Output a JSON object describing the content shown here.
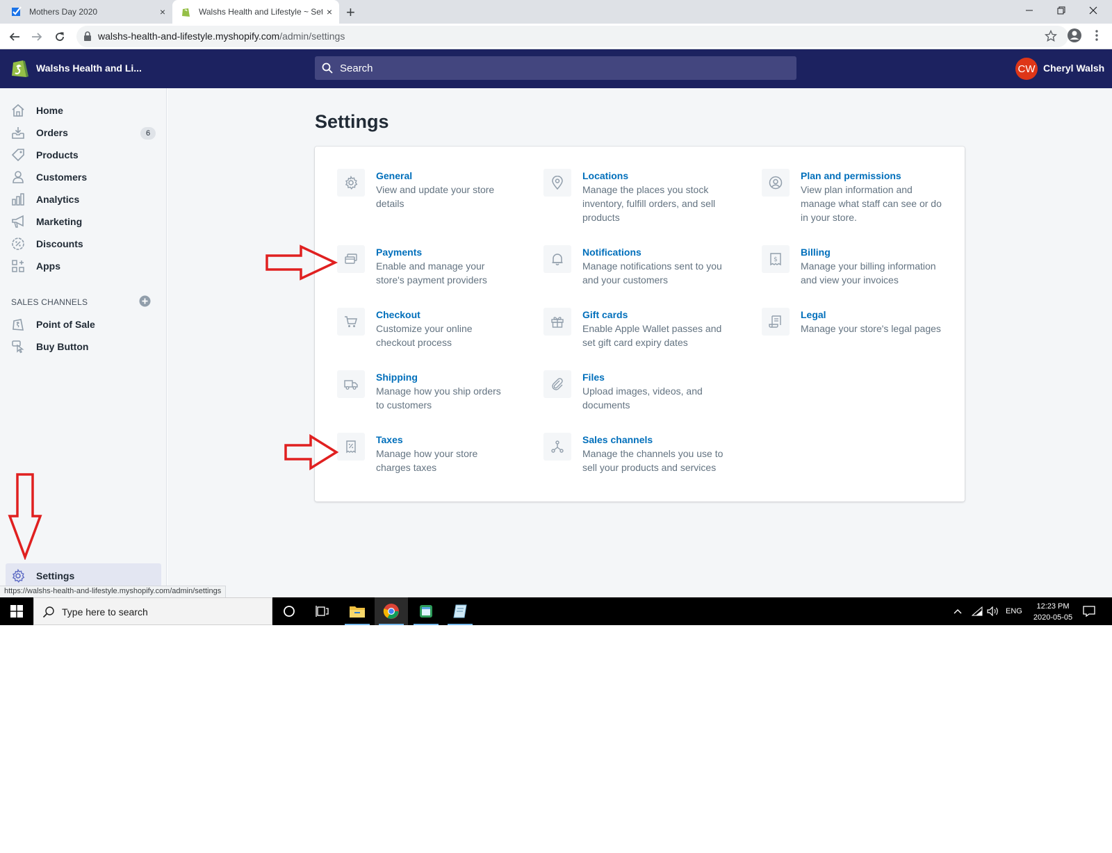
{
  "browser": {
    "tabs": [
      {
        "title": "Mothers Day 2020",
        "close": "×"
      },
      {
        "title": "Walshs Health and Lifestyle ~ Settings",
        "close": "×"
      }
    ],
    "new_tab": "+",
    "url_domain": "walshs-health-and-lifestyle.myshopify.com",
    "url_path": "/admin/settings",
    "status_url": "https://walshs-health-and-lifestyle.myshopify.com/admin/settings"
  },
  "topbar": {
    "shop_name": "Walshs Health and Li...",
    "search_placeholder": "Search",
    "avatar_initials": "CW",
    "user_name": "Cheryl Walsh",
    "accent": "#1c2260",
    "avatar_color": "#de3618"
  },
  "sidebar": {
    "items": [
      {
        "label": "Home",
        "icon": "home-icon"
      },
      {
        "label": "Orders",
        "icon": "orders-icon",
        "badge": "6"
      },
      {
        "label": "Products",
        "icon": "tag-icon"
      },
      {
        "label": "Customers",
        "icon": "person-icon"
      },
      {
        "label": "Analytics",
        "icon": "bar-chart-icon"
      },
      {
        "label": "Marketing",
        "icon": "megaphone-icon"
      },
      {
        "label": "Discounts",
        "icon": "discount-icon"
      },
      {
        "label": "Apps",
        "icon": "apps-icon"
      }
    ],
    "sales_channels_heading": "SALES CHANNELS",
    "channels": [
      {
        "label": "Point of Sale",
        "icon": "pos-icon"
      },
      {
        "label": "Buy Button",
        "icon": "buy-button-icon"
      }
    ],
    "settings_label": "Settings"
  },
  "main": {
    "title": "Settings",
    "settings": [
      {
        "title": "General",
        "desc": [
          "View and update your store",
          "details"
        ],
        "icon": "gear-icon"
      },
      {
        "title": "Locations",
        "desc": [
          "Manage the places you stock",
          "inventory, fulfill orders, and sell",
          "products"
        ],
        "icon": "location-pin-icon"
      },
      {
        "title": "Plan and permissions",
        "desc": [
          "View plan information and",
          "manage what staff can see or do",
          "in your store."
        ],
        "icon": "user-circle-icon"
      },
      {
        "title": "Payments",
        "desc": [
          "Enable and manage your",
          "store's payment providers"
        ],
        "icon": "payments-icon"
      },
      {
        "title": "Notifications",
        "desc": [
          "Manage notifications sent to you",
          "and your customers"
        ],
        "icon": "bell-icon"
      },
      {
        "title": "Billing",
        "desc": [
          "Manage your billing information",
          "and view your invoices"
        ],
        "icon": "invoice-icon"
      },
      {
        "title": "Checkout",
        "desc": [
          "Customize your online",
          "checkout process"
        ],
        "icon": "cart-icon"
      },
      {
        "title": "Gift cards",
        "desc": [
          "Enable Apple Wallet passes and",
          "set gift card expiry dates"
        ],
        "icon": "gift-icon"
      },
      {
        "title": "Legal",
        "desc": [
          "Manage your store's legal pages"
        ],
        "icon": "legal-icon"
      },
      {
        "title": "Shipping",
        "desc": [
          "Manage how you ship orders",
          "to customers"
        ],
        "icon": "truck-icon"
      },
      {
        "title": "Files",
        "desc": [
          "Upload images, videos, and",
          "documents"
        ],
        "icon": "paperclip-icon"
      },
      {
        "title": "Taxes",
        "desc": [
          "Manage how your store",
          "charges taxes"
        ],
        "icon": "tax-icon"
      },
      {
        "title": "Sales channels",
        "desc": [
          "Manage the channels you use to",
          "sell your products and services"
        ],
        "icon": "channels-icon"
      }
    ],
    "link_color": "#006fbb"
  },
  "taskbar": {
    "search_placeholder": "Type here to search",
    "language": "ENG",
    "time": "12:23 PM",
    "date": "2020-05-05"
  },
  "annotation_color": "#e02020"
}
